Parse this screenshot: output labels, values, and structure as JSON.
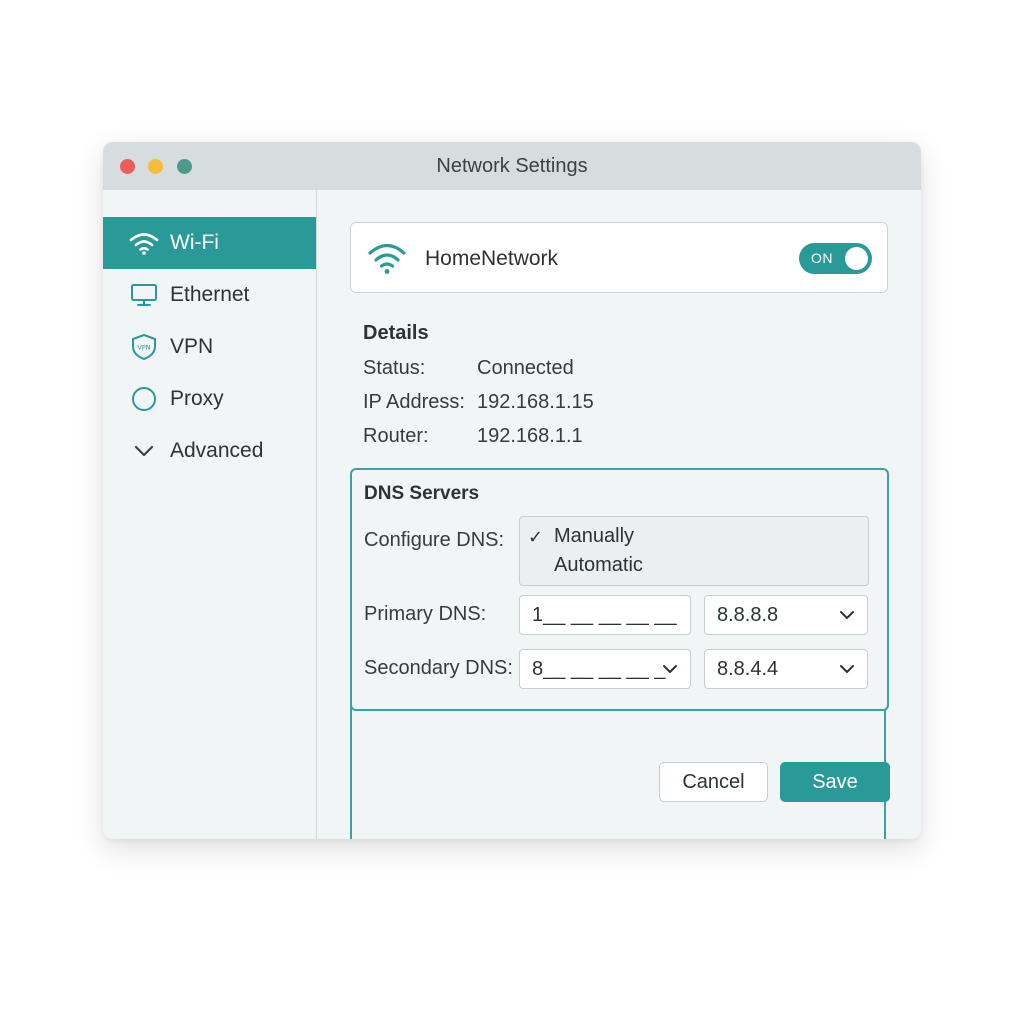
{
  "window": {
    "title": "Network Settings"
  },
  "sidebar": {
    "items": [
      {
        "label": "Wi-Fi",
        "icon": "wifi-icon",
        "active": true
      },
      {
        "label": "Ethernet",
        "icon": "monitor-icon",
        "active": false
      },
      {
        "label": "VPN",
        "icon": "vpn-shield-icon",
        "active": false
      },
      {
        "label": "Proxy",
        "icon": "circle-icon",
        "active": false
      },
      {
        "label": "Advanced",
        "icon": "chevron-down-icon",
        "active": false
      }
    ],
    "vpn_icon_text": "VPN"
  },
  "network": {
    "name": "HomeNetwork",
    "toggle_label": "ON"
  },
  "details": {
    "title": "Details",
    "rows": [
      {
        "key": "Status:",
        "value": "Connected"
      },
      {
        "key": "IP Address:",
        "value": "192.168.1.15"
      },
      {
        "key": "Router:",
        "value": "192.168.1.1"
      }
    ]
  },
  "dns": {
    "title": "DNS Servers",
    "configure_label": "Configure DNS:",
    "configure_options": [
      {
        "label": "Manually",
        "selected": true
      },
      {
        "label": "Automatic",
        "selected": false
      }
    ],
    "check_glyph": "✓",
    "primary_label": "Primary DNS:",
    "primary_input": "1__ __ __ __ __",
    "primary_select": "8.8.8.8",
    "secondary_label": "Secondary DNS:",
    "secondary_input": "8__ __ __ __ _",
    "secondary_select": "8.8.4.4"
  },
  "buttons": {
    "cancel": "Cancel",
    "save": "Save"
  },
  "colors": {
    "accent": "#2a9a98",
    "close": "#ec5e56",
    "minimize": "#f3be3c",
    "maximize": "#4e9a8a"
  }
}
